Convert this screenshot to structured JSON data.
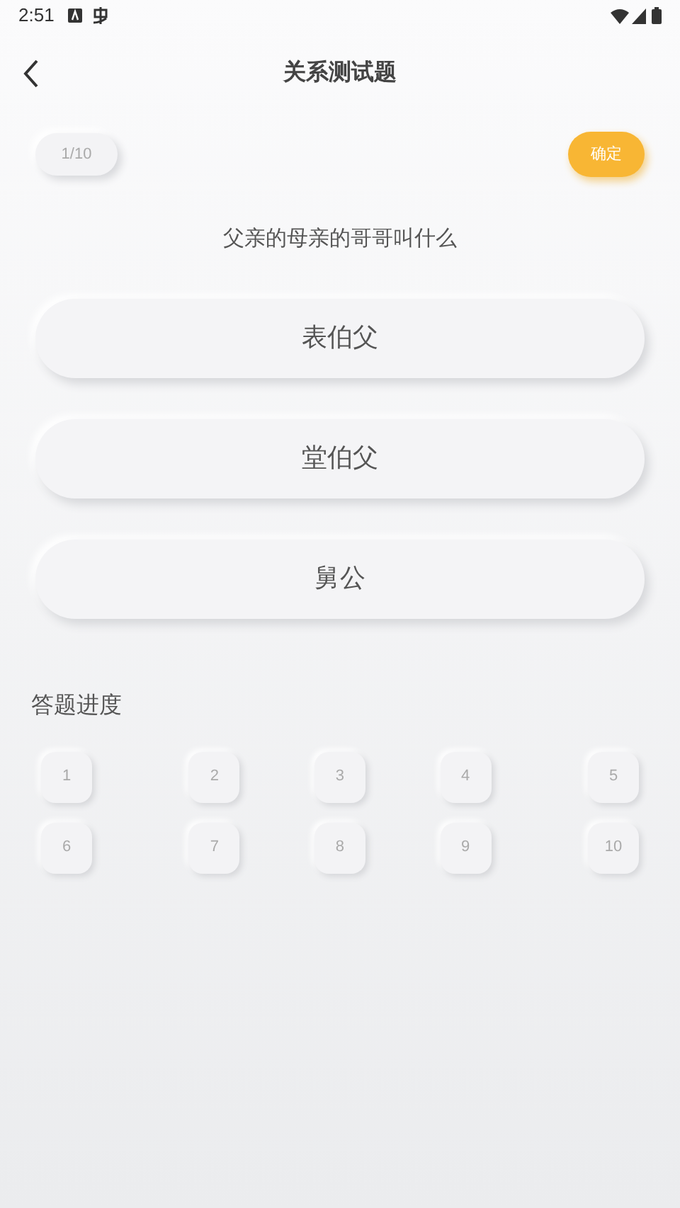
{
  "status_bar": {
    "time": "2:51"
  },
  "header": {
    "title": "关系测试题"
  },
  "counter": "1/10",
  "confirm_button": "确定",
  "question": "父亲的母亲的哥哥叫什么",
  "options": [
    {
      "label": "表伯父",
      "selected": false
    },
    {
      "label": "堂伯父",
      "selected": false
    },
    {
      "label": "舅公",
      "selected": false
    }
  ],
  "progress": {
    "title": "答题进度",
    "items": [
      {
        "label": "1",
        "answered": false
      },
      {
        "label": "2",
        "answered": false
      },
      {
        "label": "3",
        "answered": false
      },
      {
        "label": "4",
        "answered": false
      },
      {
        "label": "5",
        "answered": false
      },
      {
        "label": "6",
        "answered": false
      },
      {
        "label": "7",
        "answered": false
      },
      {
        "label": "8",
        "answered": false
      },
      {
        "label": "9",
        "answered": false
      },
      {
        "label": "10",
        "answered": false
      }
    ]
  }
}
